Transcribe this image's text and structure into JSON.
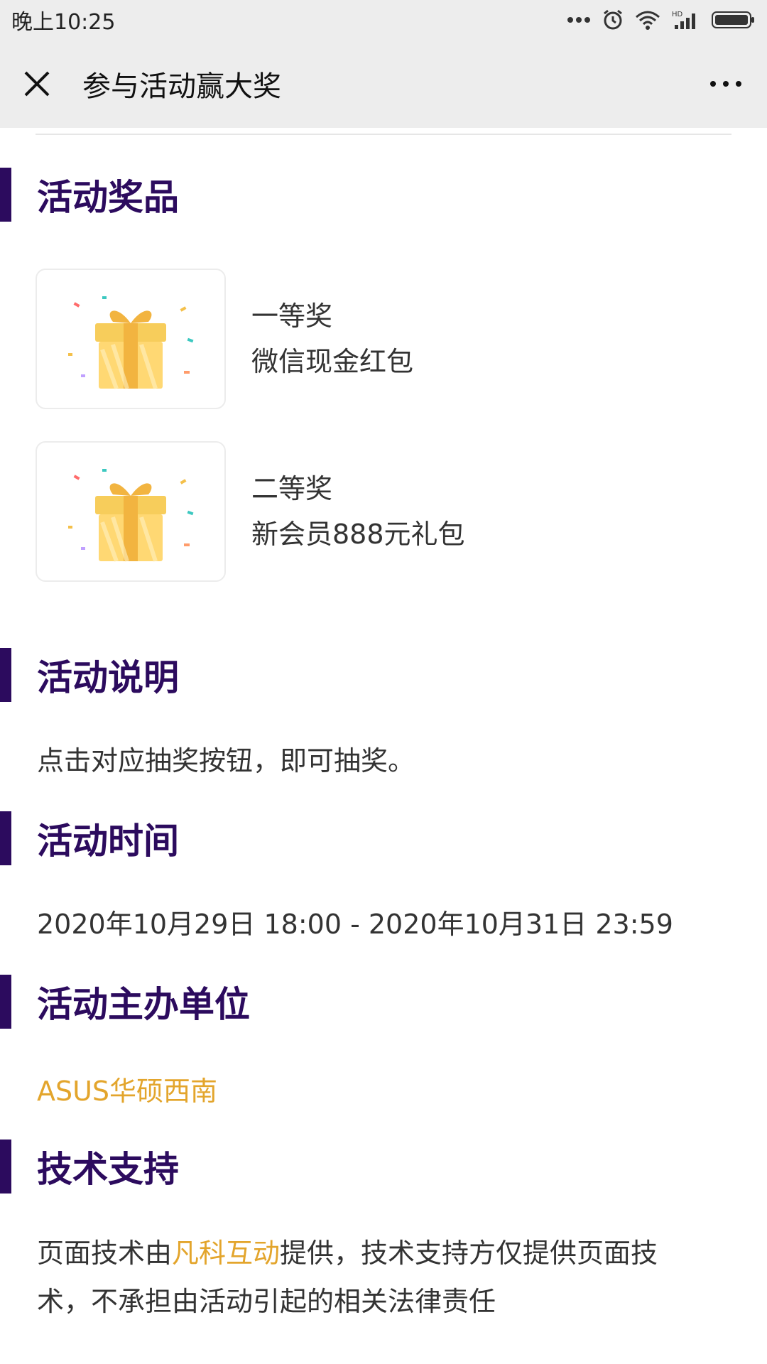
{
  "status_bar": {
    "time": "晚上10:25",
    "icons": [
      "more-dots-icon",
      "alarm-icon",
      "wifi-icon",
      "hd-signal-icon",
      "battery-icon"
    ]
  },
  "nav": {
    "title": "参与活动赢大奖",
    "close_icon": "close-icon",
    "more_icon": "more-icon"
  },
  "sections": {
    "prizes": {
      "title": "活动奖品",
      "items": [
        {
          "level": "一等奖",
          "name": "微信现金红包",
          "icon": "gift-box-icon"
        },
        {
          "level": "二等奖",
          "name": "新会员888元礼包",
          "icon": "gift-box-icon"
        }
      ]
    },
    "description": {
      "title": "活动说明",
      "text": "点击对应抽奖按钮，即可抽奖。"
    },
    "time": {
      "title": "活动时间",
      "text": "2020年10月29日 18:00 - 2020年10月31日 23:59"
    },
    "organizer": {
      "title": "活动主办单位",
      "text": "ASUS华硕西南"
    },
    "tech": {
      "title": "技术支持",
      "prefix": "页面技术由",
      "provider": "凡科互动",
      "suffix": "提供，技术支持方仅提供页面技术，不承担由活动引起的相关法律责任"
    }
  },
  "colors": {
    "accent": "#2c0b5e",
    "highlight": "#e3a52c",
    "bar_bg": "#ededed"
  }
}
